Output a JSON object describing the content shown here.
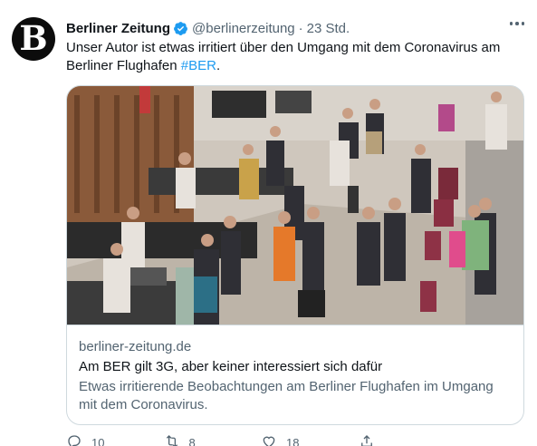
{
  "author": {
    "name": "Berliner Zeitung",
    "handle": "@berlinerzeitung",
    "separator": "·",
    "time": "23 Std.",
    "avatar_letter": "B"
  },
  "tweet": {
    "text_before": "Unser Autor ist etwas irritiert über den Umgang mit dem Coronavirus am Berliner Flughafen ",
    "hashtag": "#BER",
    "text_after": "."
  },
  "card": {
    "domain": "berliner-zeitung.de",
    "title": "Am BER gilt 3G, aber keiner interessiert sich dafür",
    "description": "Etwas irritierende Beobachtungen am Berliner Flughafen im Umgang mit dem Coronavirus."
  },
  "actions": {
    "replies": "10",
    "retweets": "8",
    "likes": "18"
  },
  "colors": {
    "accent": "#1d9bf0",
    "secondary_text": "#536471",
    "border": "#cfd9de"
  },
  "icons": [
    "verified-badge-icon",
    "more-icon",
    "reply-icon",
    "retweet-icon",
    "like-icon",
    "share-icon"
  ]
}
